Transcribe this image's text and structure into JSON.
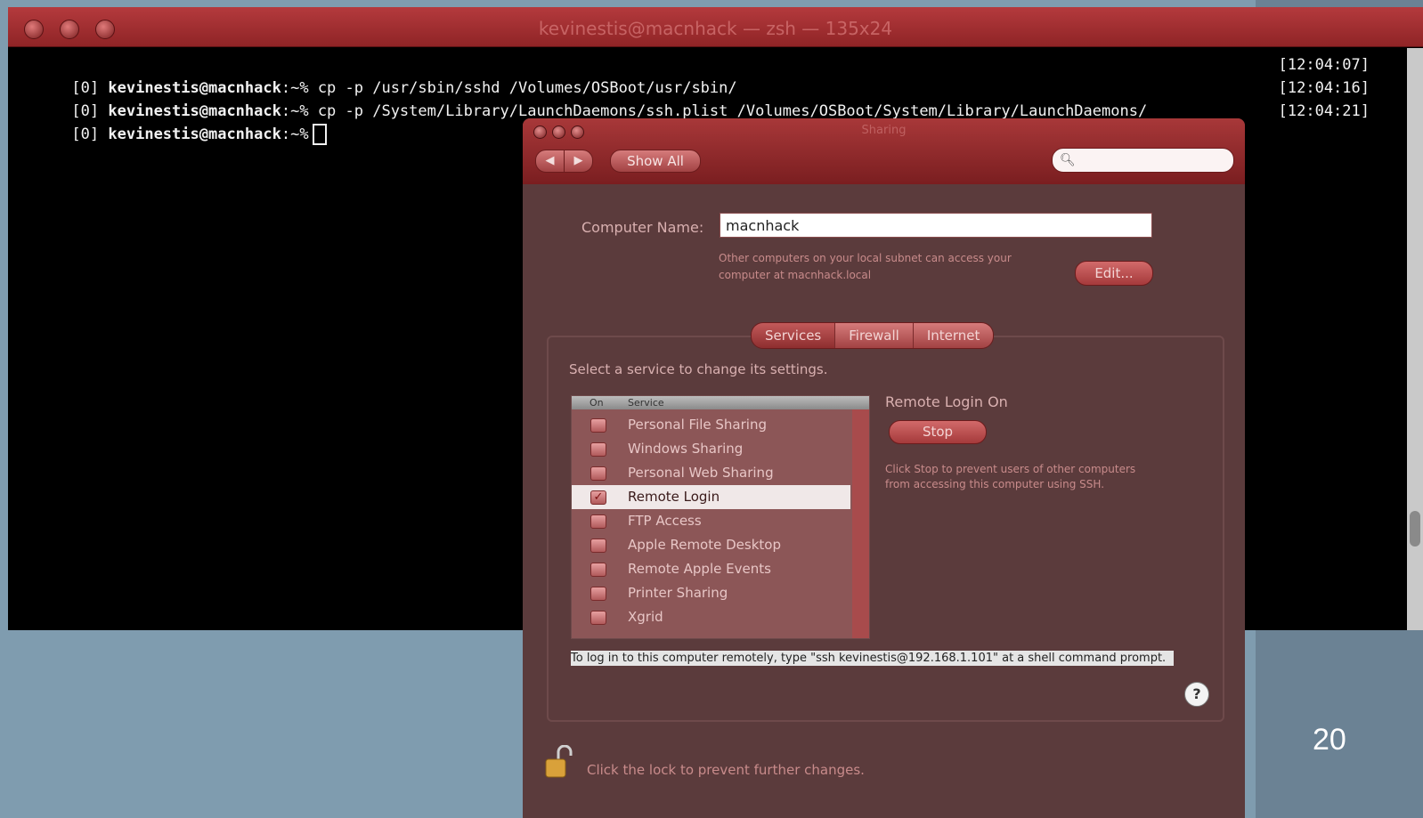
{
  "terminal": {
    "title": "kevinestis@macnhack — zsh — 135x24",
    "lines": [
      {
        "prefix": "[0]",
        "user": "kevinestis@macnhack",
        "cwd": ":~%",
        "cmd": " cp -p /usr/sbin/sshd /Volumes/OSBoot/usr/sbin/",
        "time": "[12:04:07]"
      },
      {
        "prefix": "[0]",
        "user": "kevinestis@macnhack",
        "cwd": ":~%",
        "cmd": " cp -p /System/Library/LaunchDaemons/ssh.plist /Volumes/OSBoot/System/Library/LaunchDaemons/",
        "time": "[12:04:16]"
      },
      {
        "prefix": "[0]",
        "user": "kevinestis@macnhack",
        "cwd": ":~%",
        "cmd": "",
        "time": "[12:04:21]"
      }
    ]
  },
  "sharing": {
    "title": "Sharing",
    "nav_back": "◀",
    "nav_forward": "▶",
    "show_all": "Show All",
    "search_placeholder": "",
    "computer_name_label": "Computer Name:",
    "computer_name_value": "macnhack",
    "computer_name_note": "Other computers on your local subnet can access your computer at macnhack.local",
    "edit_label": "Edit...",
    "tabs": [
      "Services",
      "Firewall",
      "Internet"
    ],
    "select_prompt": "Select a service to change its settings.",
    "list_header": {
      "on": "On",
      "service": "Service"
    },
    "services": [
      {
        "name": "Personal File Sharing",
        "on": false
      },
      {
        "name": "Windows Sharing",
        "on": false
      },
      {
        "name": "Personal Web Sharing",
        "on": false
      },
      {
        "name": "Remote Login",
        "on": true
      },
      {
        "name": "FTP Access",
        "on": false
      },
      {
        "name": "Apple Remote Desktop",
        "on": false
      },
      {
        "name": "Remote Apple Events",
        "on": false
      },
      {
        "name": "Printer Sharing",
        "on": false
      },
      {
        "name": "Xgrid",
        "on": false
      }
    ],
    "status_title": "Remote Login On",
    "stop_label": "Stop",
    "status_note": "Click Stop to prevent users of other computers from accessing this computer using SSH.",
    "command_hint": "To log in to this computer remotely, type \"ssh kevinestis@192.168.1.101\" at a shell command prompt.",
    "help_label": "?",
    "lock_text": "Click the lock to prevent further changes."
  },
  "slide_number": "20",
  "colors": {
    "accent": "#a83839",
    "window_bg": "#5b3b3c",
    "page_bg": "#7f9caf"
  }
}
